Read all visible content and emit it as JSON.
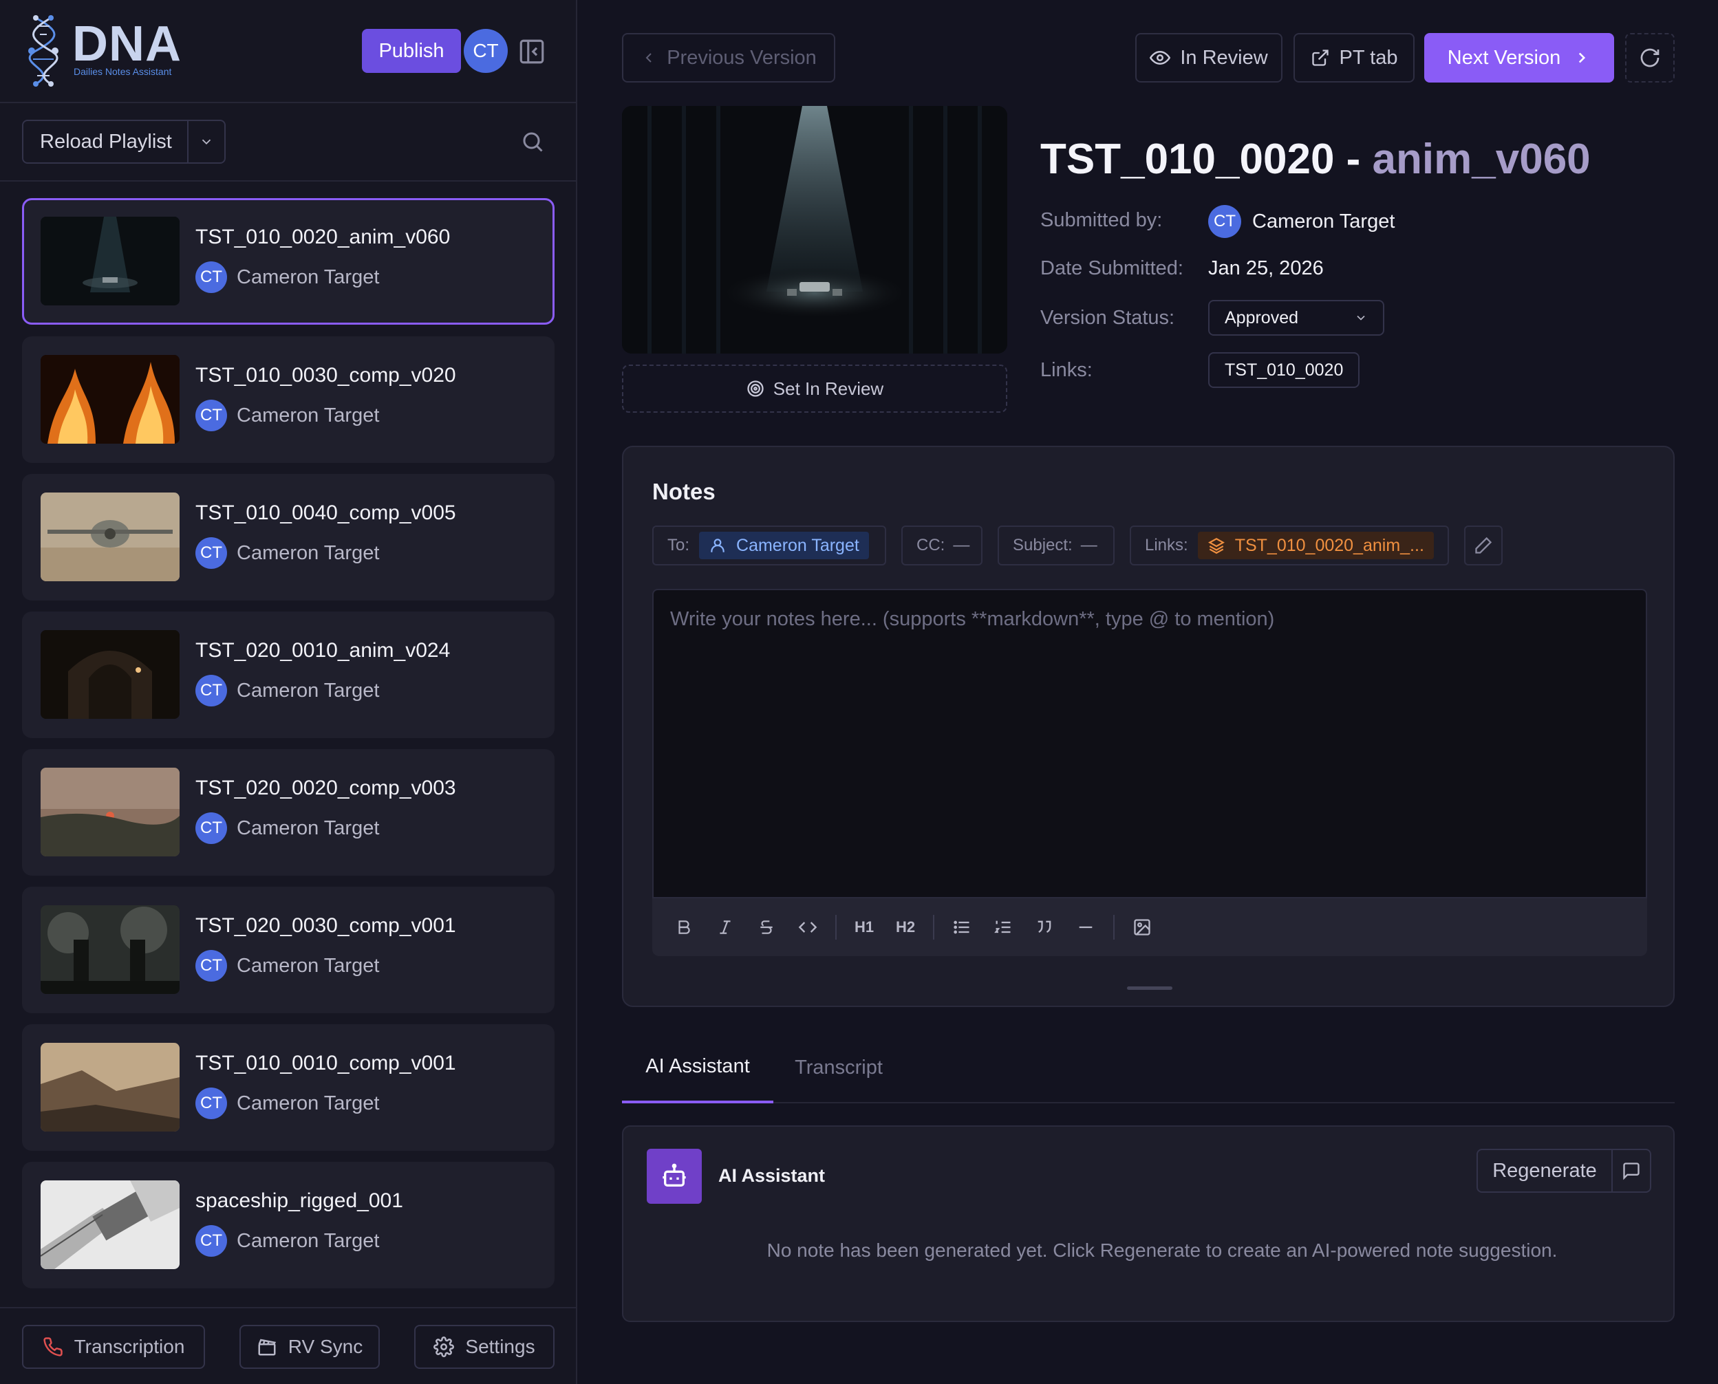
{
  "app": {
    "logo_text": "DNA",
    "logo_subtitle": "Dailies Notes Assistant",
    "publish_label": "Publish",
    "user_initials": "CT"
  },
  "sidebar": {
    "reload_label": "Reload Playlist",
    "versions": [
      {
        "title": "TST_010_0020_anim_v060",
        "user": "Cameron Target",
        "initials": "CT",
        "selected": true,
        "thumb": "dark-spotlight"
      },
      {
        "title": "TST_010_0030_comp_v020",
        "user": "Cameron Target",
        "initials": "CT",
        "selected": false,
        "thumb": "fire"
      },
      {
        "title": "TST_010_0040_comp_v005",
        "user": "Cameron Target",
        "initials": "CT",
        "selected": false,
        "thumb": "spacecraft-desert"
      },
      {
        "title": "TST_020_0010_anim_v024",
        "user": "Cameron Target",
        "initials": "CT",
        "selected": false,
        "thumb": "dark-tunnel"
      },
      {
        "title": "TST_020_0020_comp_v003",
        "user": "Cameron Target",
        "initials": "CT",
        "selected": false,
        "thumb": "sunset-hills"
      },
      {
        "title": "TST_020_0030_comp_v001",
        "user": "Cameron Target",
        "initials": "CT",
        "selected": false,
        "thumb": "smoke-figures"
      },
      {
        "title": "TST_010_0010_comp_v001",
        "user": "Cameron Target",
        "initials": "CT",
        "selected": false,
        "thumb": "desert-cliffs"
      },
      {
        "title": "spaceship_rigged_001",
        "user": "Cameron Target",
        "initials": "CT",
        "selected": false,
        "thumb": "spaceship-model"
      }
    ],
    "footer": {
      "transcription_label": "Transcription",
      "rvsync_label": "RV Sync",
      "settings_label": "Settings"
    }
  },
  "topbar": {
    "previous_label": "Previous Version",
    "in_review_label": "In Review",
    "pt_tab_label": "PT tab",
    "next_label": "Next Version"
  },
  "version": {
    "shot": "TST_010_0020",
    "separator": " - ",
    "name": "anim_v060",
    "set_in_review_label": "Set In Review",
    "submitted_by_label": "Submitted by:",
    "submitted_by": "Cameron Target",
    "submitted_initials": "CT",
    "date_label": "Date Submitted:",
    "date": "Jan 25, 2026",
    "status_label": "Version Status:",
    "status": "Approved",
    "links_label": "Links:",
    "link": "TST_010_0020"
  },
  "notes": {
    "heading": "Notes",
    "to_label": "To:",
    "to_value": "Cameron Target",
    "cc_label": "CC:",
    "cc_value": "—",
    "subject_label": "Subject:",
    "subject_value": "—",
    "links_label": "Links:",
    "links_value": "TST_010_0020_anim_...",
    "placeholder": "Write your notes here... (supports **markdown**, type @ to mention)",
    "toolbar": {
      "h1": "H1",
      "h2": "H2"
    }
  },
  "tabs": [
    {
      "label": "AI Assistant",
      "active": true
    },
    {
      "label": "Transcript",
      "active": false
    }
  ],
  "ai_assistant": {
    "title": "AI Assistant",
    "regenerate_label": "Regenerate",
    "empty_text": "No note has been generated yet. Click Regenerate to create an AI-powered note suggestion."
  },
  "colors": {
    "accent": "#8a5cf6",
    "publish": "#6b4ee0",
    "avatar": "#4b6be0",
    "background": "#161622"
  }
}
